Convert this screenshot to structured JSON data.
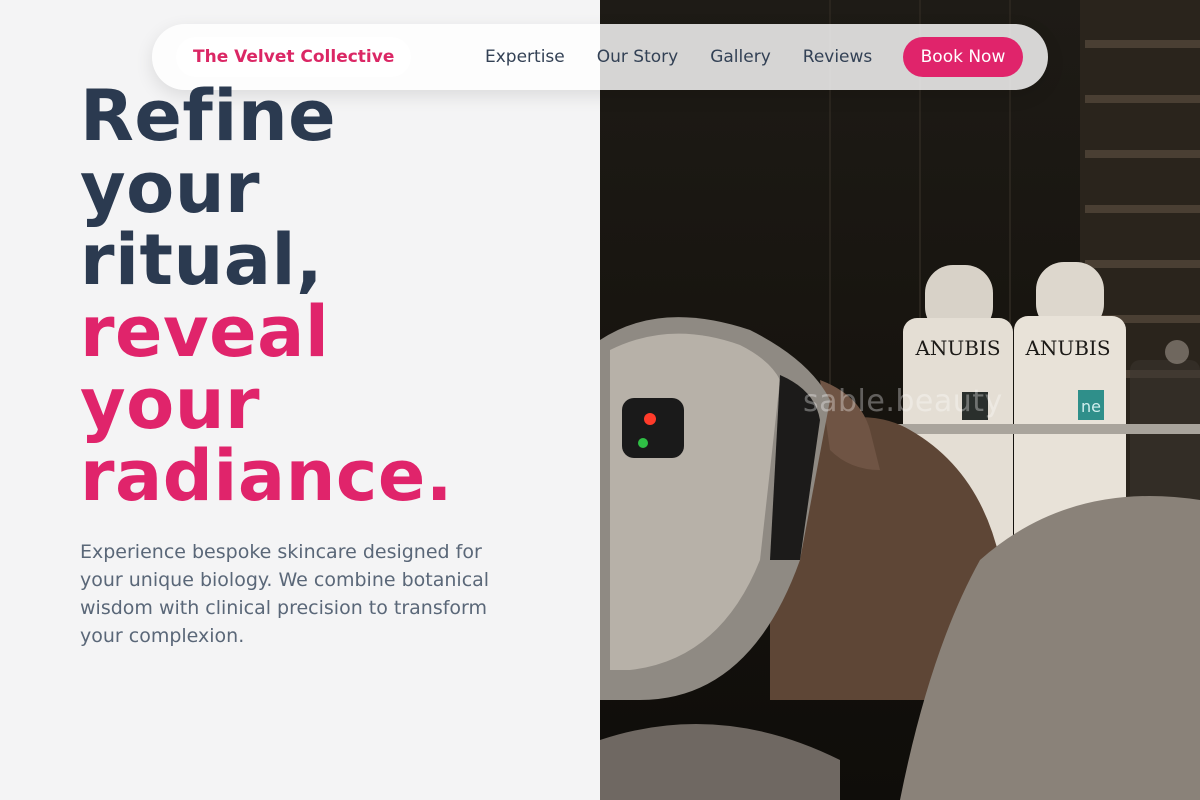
{
  "nav": {
    "brand": "The Velvet Collective",
    "links": [
      "Expertise",
      "Our Story",
      "Gallery",
      "Reviews"
    ],
    "cta": "Book Now"
  },
  "hero": {
    "headline_lines": [
      "Refine",
      "your",
      "ritual,"
    ],
    "headline_accent_lines": [
      "reveal",
      "your",
      "radiance."
    ],
    "subtitle": "Experience bespoke skincare designed for your unique biology. We combine botanical wisdom with clinical precision to transform your complexion."
  },
  "photo": {
    "watermark": "sable.beauty",
    "bottle_brand": "ANUBIS",
    "bottle_brand_2": "ANUBIS",
    "bottle_tag": "ne"
  },
  "colors": {
    "accent": "#e0246b",
    "headline_dark": "#2b3a50",
    "body_text": "#5a6778",
    "background": "#f4f4f5"
  }
}
